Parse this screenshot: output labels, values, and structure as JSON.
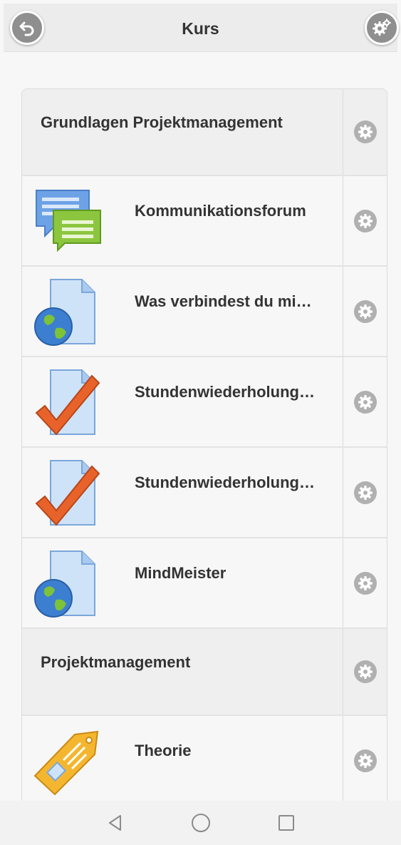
{
  "header": {
    "title": "Kurs",
    "back_icon": "back-arrow-icon",
    "settings_icon": "gears-icon"
  },
  "sections": [
    {
      "title": "Grundlagen Projektmanagement",
      "items": [
        {
          "title": "Kommunikationsforum",
          "icon": "forum-icon"
        },
        {
          "title": "Was verbindest du mi…",
          "icon": "url-icon"
        },
        {
          "title": "Stundenwiederholung…",
          "icon": "quiz-icon"
        },
        {
          "title": "Stundenwiederholung…",
          "icon": "quiz-icon"
        },
        {
          "title": "MindMeister",
          "icon": "url-icon"
        }
      ]
    },
    {
      "title": "Projektmanagement",
      "items": [
        {
          "title": "Theorie",
          "icon": "label-icon"
        }
      ]
    }
  ],
  "navbar": {
    "buttons": [
      "back-triangle-icon",
      "home-circle-icon",
      "recents-square-icon"
    ]
  },
  "colors": {
    "header_bg": "#ececec",
    "button_gray": "#8f8f8f",
    "gear_gray": "#b0b0b0",
    "text": "#333333",
    "section_bg": "#efefef"
  }
}
